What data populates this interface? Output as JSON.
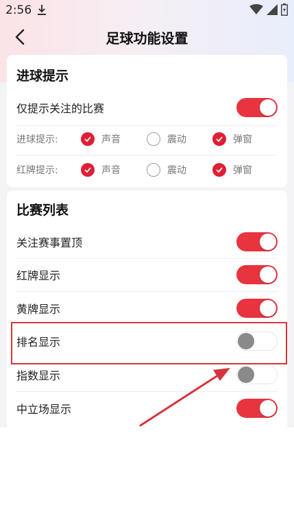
{
  "status_bar": {
    "time": "2:56"
  },
  "header": {
    "title": "足球功能设置"
  },
  "goal_section": {
    "title": "进球提示",
    "follow_only": {
      "label": "仅提示关注的比赛",
      "on": true
    },
    "goal_alert": {
      "label": "进球提示:",
      "options": [
        {
          "label": "声音",
          "checked": true
        },
        {
          "label": "震动",
          "checked": false
        },
        {
          "label": "弹窗",
          "checked": true
        }
      ]
    },
    "red_alert": {
      "label": "红牌提示:",
      "options": [
        {
          "label": "声音",
          "checked": true
        },
        {
          "label": "震动",
          "checked": false
        },
        {
          "label": "弹窗",
          "checked": true
        }
      ]
    }
  },
  "match_list": {
    "title": "比赛列表",
    "items": [
      {
        "label": "关注赛事置顶",
        "on": true
      },
      {
        "label": "红牌显示",
        "on": true
      },
      {
        "label": "黄牌显示",
        "on": true
      },
      {
        "label": "排名显示",
        "on": false
      },
      {
        "label": "指数显示",
        "on": false
      },
      {
        "label": "中立场显示",
        "on": true
      }
    ]
  },
  "colors": {
    "accent": "#e7343f",
    "check": "#e01e35",
    "highlight": "#d6343c"
  }
}
